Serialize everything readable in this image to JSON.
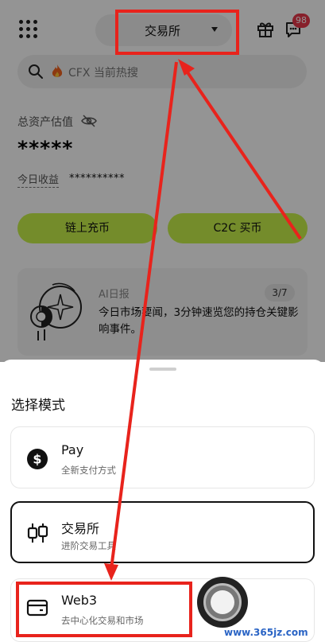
{
  "header": {
    "mode_label": "交易所",
    "notification_count": "98"
  },
  "search": {
    "placeholder": "CFX 当前热搜"
  },
  "assets": {
    "label": "总资产估值",
    "value": "*****",
    "pnl_label": "今日收益",
    "pnl_value": "**********"
  },
  "actions": {
    "deposit_label": "链上充币",
    "c2c_label": "C2C 买币"
  },
  "ai_report": {
    "title": "AI日报",
    "counter": "3/7",
    "text": "今日市场要闻，3分钟速览您的持仓关键影响事件。"
  },
  "sheet": {
    "title": "选择模式",
    "options": [
      {
        "name": "Pay",
        "desc": "全新支付方式",
        "icon": "dollar-circle-icon"
      },
      {
        "name": "交易所",
        "desc": "进阶交易工具",
        "icon": "candlestick-icon"
      },
      {
        "name": "Web3",
        "desc": "去中心化交易和市场",
        "icon": "wallet-icon"
      }
    ]
  },
  "watermark": "www.365jz.com",
  "colors": {
    "accent": "#c9f24a",
    "badge": "#e8374b",
    "annotation": "#e8231c"
  }
}
